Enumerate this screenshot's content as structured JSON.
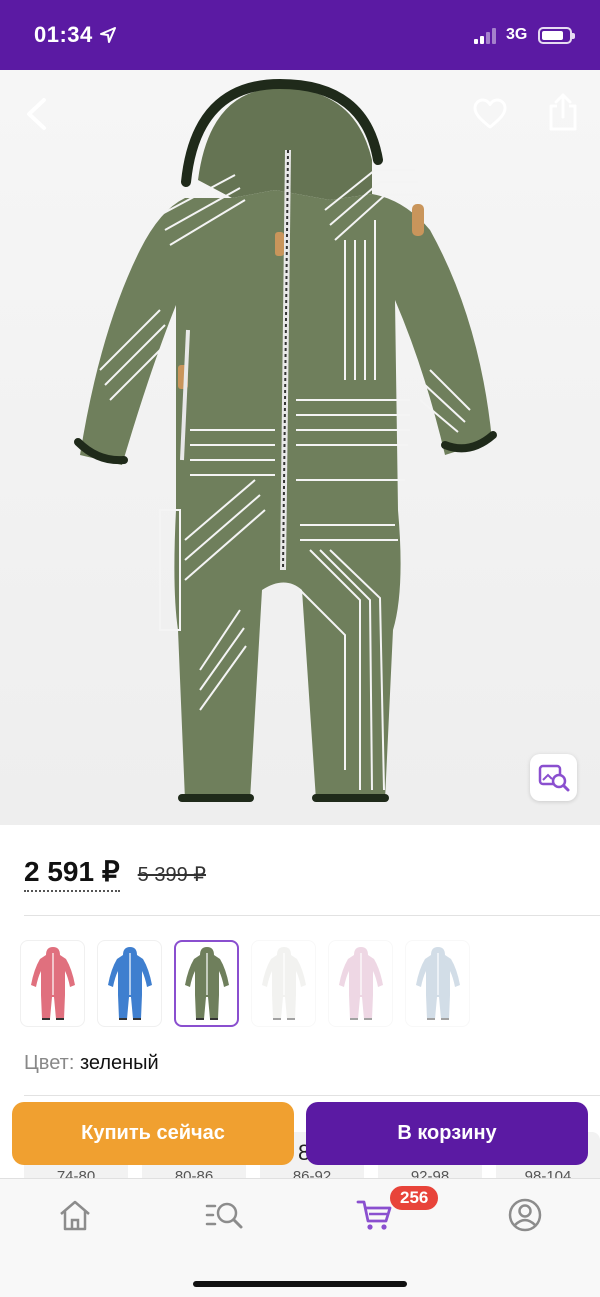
{
  "status_bar": {
    "time": "01:34",
    "network": "3G",
    "battery_level": 0.8,
    "signal_bars": 2
  },
  "product": {
    "price_current": "2 591 ₽",
    "price_old": "5 399 ₽",
    "color_label": "Цвет:",
    "color_value": "зеленый",
    "main_color": "#6f7f5c"
  },
  "swatches": [
    {
      "color": "#e0707e",
      "selected": false,
      "faded": false
    },
    {
      "color": "#3f7fcf",
      "selected": false,
      "faded": false
    },
    {
      "color": "#6f7f5c",
      "selected": true,
      "faded": false
    },
    {
      "color": "#e4e4df",
      "selected": false,
      "faded": true
    },
    {
      "color": "#dba8c4",
      "selected": false,
      "faded": true
    },
    {
      "color": "#9cb4cc",
      "selected": false,
      "faded": true
    }
  ],
  "sizes": [
    "74-80",
    "80-86",
    "86-92",
    "92-98",
    "98-104"
  ],
  "size_extra": "8",
  "actions": {
    "buy_now": "Купить сейчас",
    "add_to_cart": "В корзину"
  },
  "tabbar": {
    "cart_count": "256",
    "accent": "#8a4fcf"
  },
  "icons": [
    "back-arrow-icon",
    "heart-icon",
    "share-icon",
    "visual-search-icon",
    "home-icon",
    "catalog-search-icon",
    "cart-icon",
    "profile-icon"
  ]
}
